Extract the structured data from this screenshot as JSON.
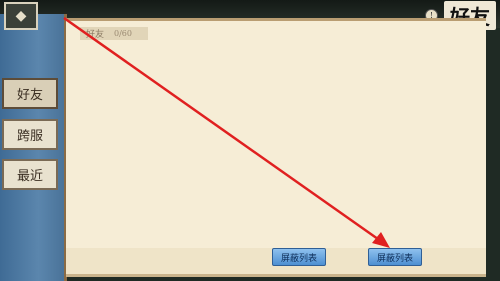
{
  "header": {
    "title": "好友",
    "info_icon": "info-icon"
  },
  "back_icon": "back-arrow-icon",
  "sidebar": {
    "items": [
      {
        "label": "好友",
        "active": true
      },
      {
        "label": "跨服",
        "active": false
      },
      {
        "label": "最近",
        "active": false
      }
    ]
  },
  "panel": {
    "tab_label": "好友",
    "tab_count": "0/60"
  },
  "footer": {
    "button_1": "屏蔽列表",
    "button_2": "屏蔽列表"
  },
  "colors": {
    "arrow": "#e02020",
    "sidebar": "#4a7399",
    "paper": "#f6edd6",
    "button": "#5b9ad6"
  }
}
